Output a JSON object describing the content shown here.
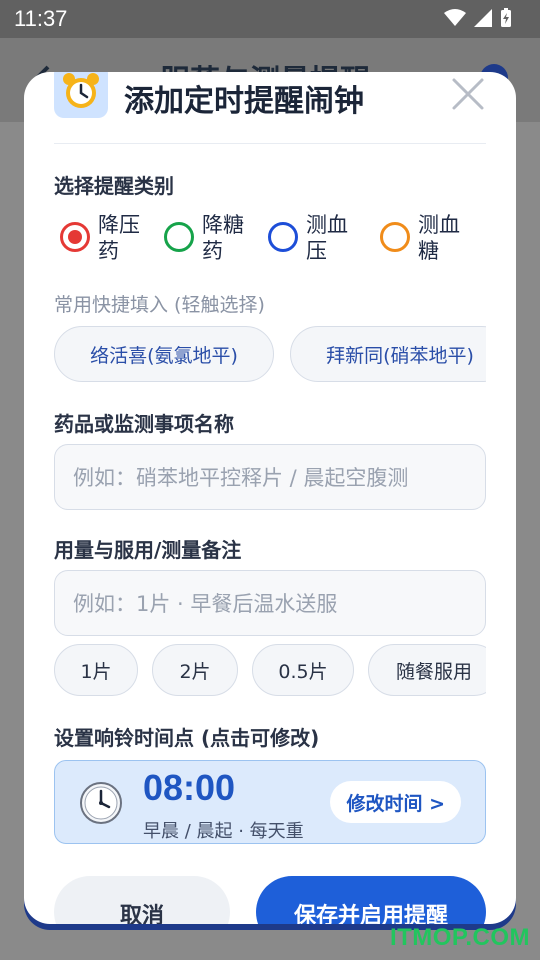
{
  "status_bar": {
    "time": "11:37"
  },
  "background": {
    "title": "服药与测量提醒"
  },
  "dialog": {
    "title": "添加定时提醒闹钟",
    "category_label": "选择提醒类别",
    "categories": [
      {
        "label": "降压药",
        "color": "#e53935",
        "selected": true
      },
      {
        "label": "降糖药",
        "color": "#16a34a",
        "selected": false
      },
      {
        "label": "测血压",
        "color": "#1d4ed8",
        "selected": false
      },
      {
        "label": "测血糖",
        "color": "#f08c1a",
        "selected": false
      }
    ],
    "quick_fill_hint": "常用快捷填入 (轻触选择)",
    "quick_chips": [
      "络活喜(氨氯地平)",
      "拜新同(硝苯地平)"
    ],
    "name_label": "药品或监测事项名称",
    "name_placeholder": "例如：硝苯地平控释片 / 晨起空腹测",
    "dose_label": "用量与服用/测量备注",
    "dose_placeholder": "例如：1片 · 早餐后温水送服",
    "dose_chips": [
      "1片",
      "2片",
      "0.5片",
      "随餐服用"
    ],
    "time_label": "设置响铃时间点 (点击可修改)",
    "time_value": "08:00",
    "time_desc": "早晨 / 晨起 · 每天重",
    "edit_time": "修改时间 >",
    "cancel": "取消",
    "save": "保存并启用提醒"
  },
  "watermark": "ITMOP.COM",
  "colors": {
    "primary": "#1e5fd9",
    "accent_light": "#dceafc"
  }
}
